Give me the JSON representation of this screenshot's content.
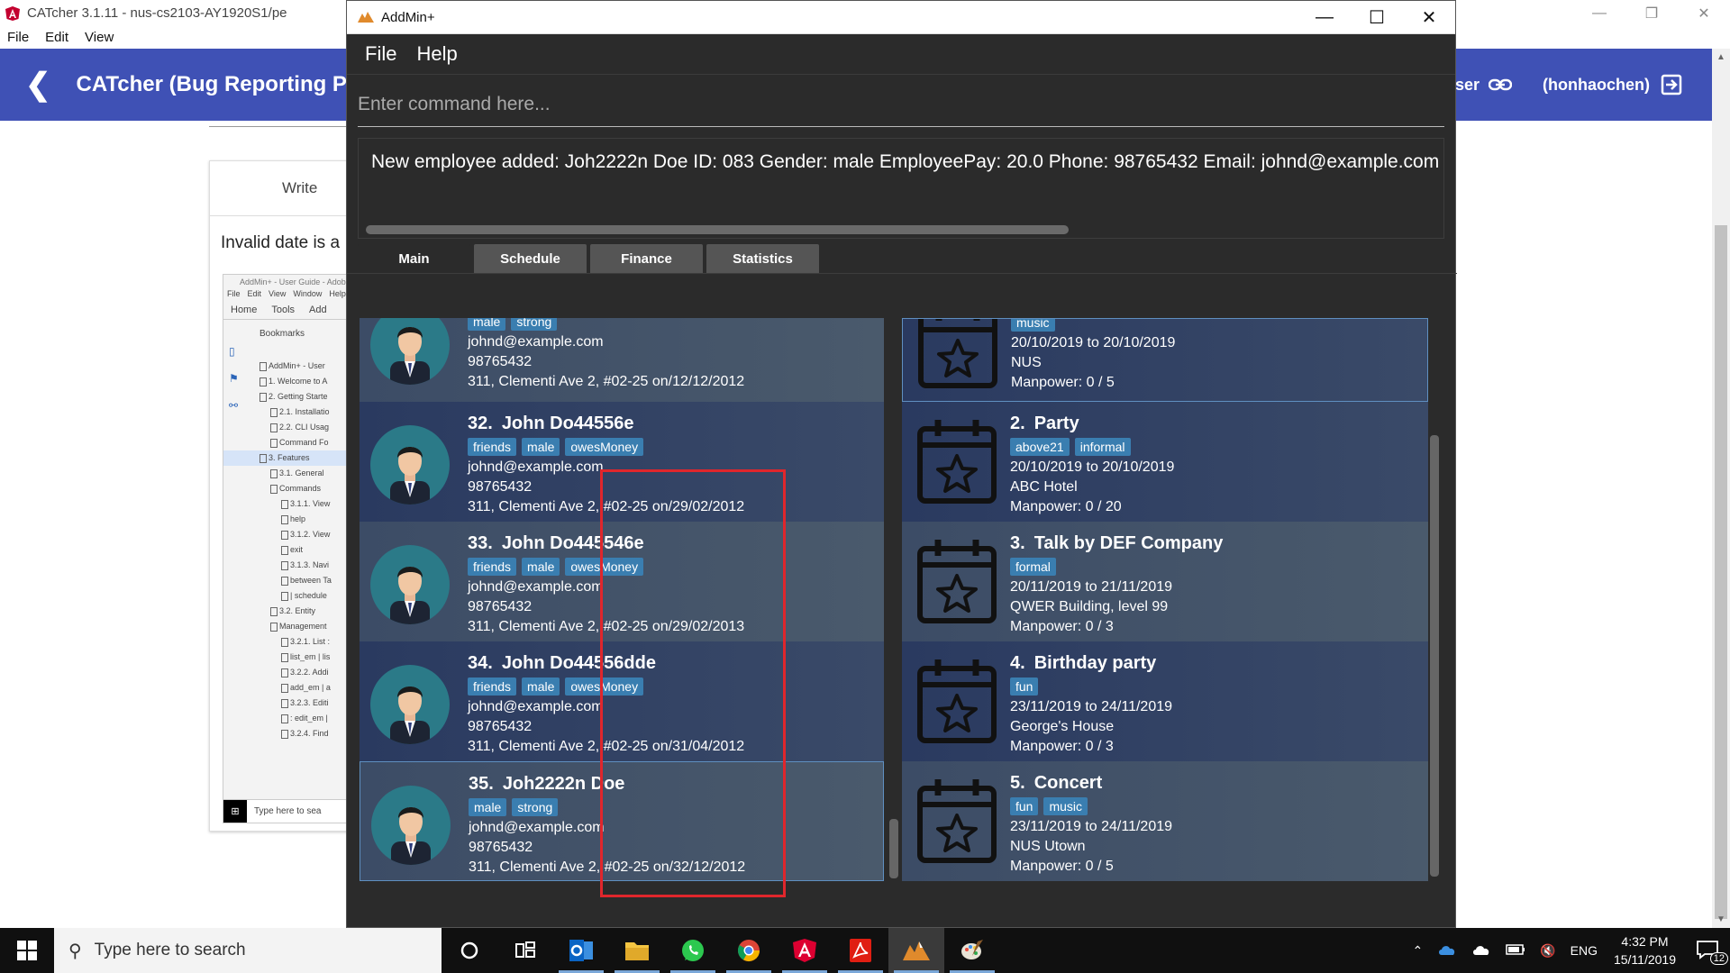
{
  "catcher": {
    "window_title": "CATcher 3.1.11 - nus-cs2103-AY1920S1/pe",
    "menu": [
      "File",
      "Edit",
      "View"
    ],
    "header_title": "CATcher  (Bug Reporting Ph",
    "user_link_label": "ser",
    "username": "(honhaochen)",
    "write_tab": "Write",
    "body_text": "Invalid date is a",
    "thumbnail": {
      "title": "AddMin+ - User Guide - Adobe A",
      "menu": [
        "File",
        "Edit",
        "View",
        "Window",
        "Help"
      ],
      "tools": [
        "Home",
        "Tools",
        "Add"
      ],
      "bookmarks_label": "Bookmarks",
      "items": [
        "AddMin+ - User",
        "1. Welcome to A",
        "2. Getting Starte",
        "2.1. Installatio",
        "2.2. CLI Usag",
        "Command Fo",
        "3. Features",
        "3.1. General",
        "Commands",
        "3.1.1. View",
        "help",
        "3.1.2. View",
        "exit",
        "3.1.3. Navi",
        "between Ta",
        "| schedule",
        "3.2. Entity",
        "Management",
        "3.2.1. List :",
        "list_em | lis",
        "3.2.2. Addi",
        "add_em | a",
        "3.2.3. Editi",
        ": edit_em |",
        "3.2.4. Find"
      ],
      "taskbar_search": "Type here to sea"
    }
  },
  "addmin": {
    "window_title": "AddMin+",
    "menu": [
      "File",
      "Help"
    ],
    "command_placeholder": "Enter command here...",
    "result_text": "New employee added: Joh2222n Doe ID: 083 Gender: male EmployeePay: 20.0 Phone: 98765432 Email: johnd@example.com Addr",
    "tabs": [
      "Main",
      "Schedule",
      "Finance",
      "Statistics"
    ],
    "employees": [
      {
        "index": "",
        "name": "",
        "tags": [
          "male",
          "strong"
        ],
        "email": "johnd@example.com",
        "phone": "98765432",
        "address": "311, Clementi Ave 2, #02-25 on/12/12/2012"
      },
      {
        "index": "32.",
        "name": "John Do44556e",
        "tags": [
          "friends",
          "male",
          "owesMoney"
        ],
        "email": "johnd@example.com",
        "phone": "98765432",
        "address": "311, Clementi Ave 2, #02-25 on/29/02/2012"
      },
      {
        "index": "33.",
        "name": "John Do445546e",
        "tags": [
          "friends",
          "male",
          "owesMoney"
        ],
        "email": "johnd@example.com",
        "phone": "98765432",
        "address": "311, Clementi Ave 2, #02-25 on/29/02/2013"
      },
      {
        "index": "34.",
        "name": "John Do44556dde",
        "tags": [
          "friends",
          "male",
          "owesMoney"
        ],
        "email": "johnd@example.com",
        "phone": "98765432",
        "address": "311, Clementi Ave 2, #02-25 on/31/04/2012"
      },
      {
        "index": "35.",
        "name": "Joh2222n Doe",
        "tags": [
          "male",
          "strong"
        ],
        "email": "johnd@example.com",
        "phone": "98765432",
        "address": "311, Clementi Ave 2, #02-25 on/32/12/2012"
      }
    ],
    "events": [
      {
        "index": "",
        "name": "",
        "tags": [
          "music"
        ],
        "dates": "20/10/2019 to 20/10/2019",
        "venue": "NUS",
        "manpower": "Manpower: 0 / 5"
      },
      {
        "index": "2.",
        "name": "Party",
        "tags": [
          "above21",
          "informal"
        ],
        "dates": "20/10/2019 to 20/10/2019",
        "venue": "ABC Hotel",
        "manpower": "Manpower: 0 / 20"
      },
      {
        "index": "3.",
        "name": "Talk by DEF Company",
        "tags": [
          "formal"
        ],
        "dates": "20/11/2019 to 21/11/2019",
        "venue": "QWER Building, level 99",
        "manpower": "Manpower: 0 / 3"
      },
      {
        "index": "4.",
        "name": "Birthday party",
        "tags": [
          "fun"
        ],
        "dates": "23/11/2019 to 24/11/2019",
        "venue": "George's House",
        "manpower": "Manpower: 0 / 3"
      },
      {
        "index": "5.",
        "name": "Concert",
        "tags": [
          "fun",
          "music"
        ],
        "dates": "23/11/2019 to 24/11/2019",
        "venue": "NUS Utown",
        "manpower": "Manpower: 0 / 5"
      }
    ]
  },
  "taskbar": {
    "search_placeholder": "Type here to search",
    "apps": [
      "cortana-icon",
      "task-view-icon",
      "outlook-icon",
      "file-explorer-icon",
      "whatsapp-icon",
      "chrome-icon",
      "angular-icon",
      "acrobat-icon",
      "addmin-icon",
      "paint-icon"
    ],
    "language": "ENG",
    "time": "4:32 PM",
    "date": "15/11/2019",
    "notification_count": "12"
  },
  "colors": {
    "catcher_header": "#3f51b5",
    "addmin_bg": "#2b2b2b",
    "tag": "#3a7eb0",
    "highlight": "#e0262c"
  }
}
